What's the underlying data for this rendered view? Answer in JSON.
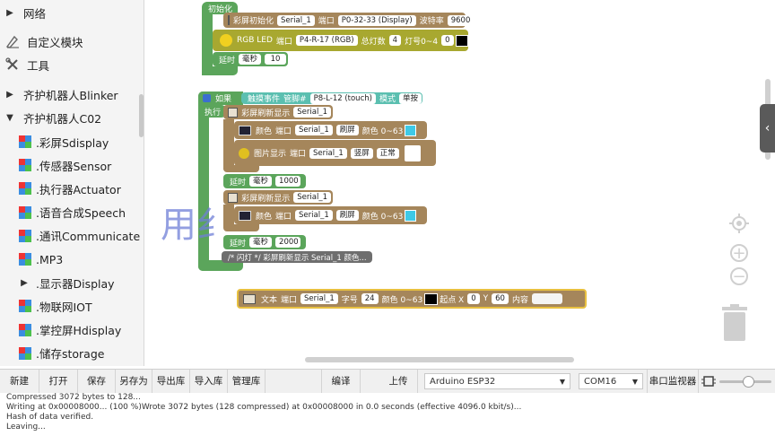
{
  "sidebar": {
    "items": [
      {
        "label": "网络",
        "type": "folder",
        "expanded": false
      },
      {
        "label": "自定义模块",
        "type": "tool",
        "icon": "custom-module-icon"
      },
      {
        "label": "工具",
        "type": "tool",
        "icon": "tools-icon"
      },
      {
        "label": "齐护机器人Blinker",
        "type": "folder",
        "expanded": false
      },
      {
        "label": "齐护机器人C02",
        "type": "folder",
        "expanded": true
      },
      {
        "label": ".彩屏Sdisplay",
        "type": "category"
      },
      {
        "label": ".传感器Sensor",
        "type": "category"
      },
      {
        "label": ".执行器Actuator",
        "type": "category"
      },
      {
        "label": ".语音合成Speech",
        "type": "category"
      },
      {
        "label": ".通讯Communicate",
        "type": "category"
      },
      {
        "label": ".MP3",
        "type": "category"
      },
      {
        "label": ".显示器Display",
        "type": "subfolder",
        "expanded": false
      },
      {
        "label": ".物联网IOT",
        "type": "category"
      },
      {
        "label": ".掌控屏Hdisplay",
        "type": "category"
      },
      {
        "label": ".储存storage",
        "type": "category"
      }
    ]
  },
  "blocks": {
    "init_hat": "初始化",
    "screen_init": {
      "label": "彩屏初始化",
      "serial": "Serial_1",
      "port_label": "端口",
      "port": "P0-32-33 (Display)",
      "baud_label": "波特率",
      "baud": "9600"
    },
    "rgb": {
      "label": "RGB LED",
      "port_label": "端口",
      "port": "P4-R-17 (RGB)",
      "total_label": "总灯数",
      "total": "4",
      "index_label": "灯号0~4",
      "index": "0"
    },
    "delay1": {
      "label": "延时",
      "unit": "毫秒",
      "value": "10"
    },
    "if_block": {
      "if_label": "如果",
      "event": "触摸事件",
      "pin_label": "管脚#",
      "pin": "P8-L-12 (touch)",
      "mode_label": "模式",
      "mode": "单按",
      "exec": "执行"
    },
    "refresh1": {
      "label": "彩屏刷新显示",
      "serial": "Serial_1"
    },
    "color1": {
      "label": "颜色",
      "port_label": "端口",
      "serial": "Serial_1",
      "mode": "刷屏",
      "range": "颜色 0~63"
    },
    "image1": {
      "label": "图片显示",
      "port_label": "端口",
      "serial": "Serial_1",
      "opt1": "竖屏",
      "opt2": "正常"
    },
    "delay2": {
      "label": "延时",
      "unit": "毫秒",
      "value": "1000"
    },
    "refresh2": {
      "label": "彩屏刷新显示",
      "serial": "Serial_1"
    },
    "color2": {
      "label": "颜色",
      "port_label": "端口",
      "serial": "Serial_1",
      "mode": "刷屏",
      "range": "颜色 0~63"
    },
    "delay3": {
      "label": "延时",
      "unit": "毫秒",
      "value": "2000"
    },
    "comment": "/* 闪灯 */ 彩屏刷新显示 Serial_1 颜色...",
    "text_block": {
      "label": "文本",
      "port_label": "端口",
      "serial": "Serial_1",
      "size_label": "字号",
      "size": "24",
      "color_label": "颜色 0~63",
      "start_label": "起点 X",
      "x": "0",
      "y_label": "Y",
      "y": "60",
      "content_label": "内容"
    }
  },
  "watermark": "用纟",
  "colors": {
    "cyan_swatch": "#3ec9e6",
    "black_swatch": "#000000",
    "green_block": "#5ba55b",
    "brown_block": "#a5865b",
    "olive_block": "#a8a830"
  },
  "toolbar": {
    "buttons": [
      "新建",
      "打开",
      "保存",
      "另存为",
      "导出库",
      "导入库",
      "管理库"
    ],
    "compile": "编译",
    "upload": "上传",
    "board": "Arduino ESP32",
    "port": "COM16",
    "serial_monitor": "串口监视器"
  },
  "console": {
    "lines": [
      "Compressed 3072 bytes to 128...",
      "Writing at 0x00008000... (100 %)Wrote 3072 bytes (128 compressed) at 0x00008000 in 0.0 seconds (effective 4096.0 kbit/s)...",
      "Hash of data verified.",
      "Leaving..."
    ]
  }
}
